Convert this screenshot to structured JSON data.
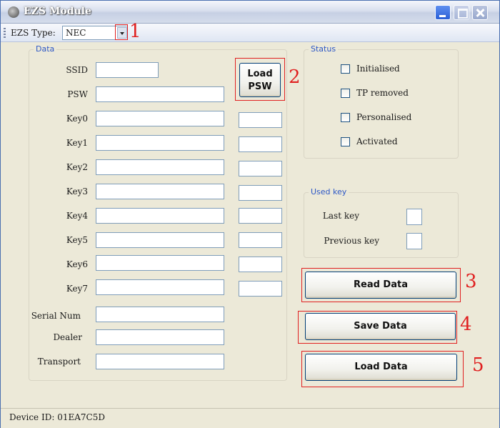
{
  "window": {
    "title": "EZS Module"
  },
  "toolbar": {
    "ezs_type_label": "EZS Type:",
    "ezs_type_value": "NEC"
  },
  "data_group": {
    "legend": "Data",
    "fields": [
      {
        "label": "SSID",
        "value": ""
      },
      {
        "label": "PSW",
        "value": ""
      },
      {
        "label": "Key0",
        "value": ""
      },
      {
        "label": "Key1",
        "value": ""
      },
      {
        "label": "Key2",
        "value": ""
      },
      {
        "label": "Key3",
        "value": ""
      },
      {
        "label": "Key4",
        "value": ""
      },
      {
        "label": "Key5",
        "value": ""
      },
      {
        "label": "Key6",
        "value": ""
      },
      {
        "label": "Key7",
        "value": ""
      },
      {
        "label": "Serial Num",
        "value": ""
      },
      {
        "label": "Dealer",
        "value": ""
      },
      {
        "label": "Transport",
        "value": ""
      }
    ],
    "load_psw_label": [
      "Load",
      "PSW"
    ]
  },
  "status_group": {
    "legend": "Status",
    "items": [
      {
        "label": "Initialised",
        "checked": false
      },
      {
        "label": "TP removed",
        "checked": false
      },
      {
        "label": "Personalised",
        "checked": false
      },
      {
        "label": "Activated",
        "checked": false
      }
    ]
  },
  "used_key_group": {
    "legend": "Used key",
    "last_key_label": "Last key",
    "previous_key_label": "Previous key"
  },
  "actions": {
    "read_data": "Read Data",
    "save_data": "Save Data",
    "load_data": "Load Data"
  },
  "annotations": [
    "1",
    "2",
    "3",
    "4",
    "5"
  ],
  "statusbar": {
    "device_id": "Device ID: 01EA7C5D"
  },
  "colors": {
    "annotation": "#e02020",
    "legend": "#2d57c5",
    "window_bg": "#ece9d8"
  }
}
